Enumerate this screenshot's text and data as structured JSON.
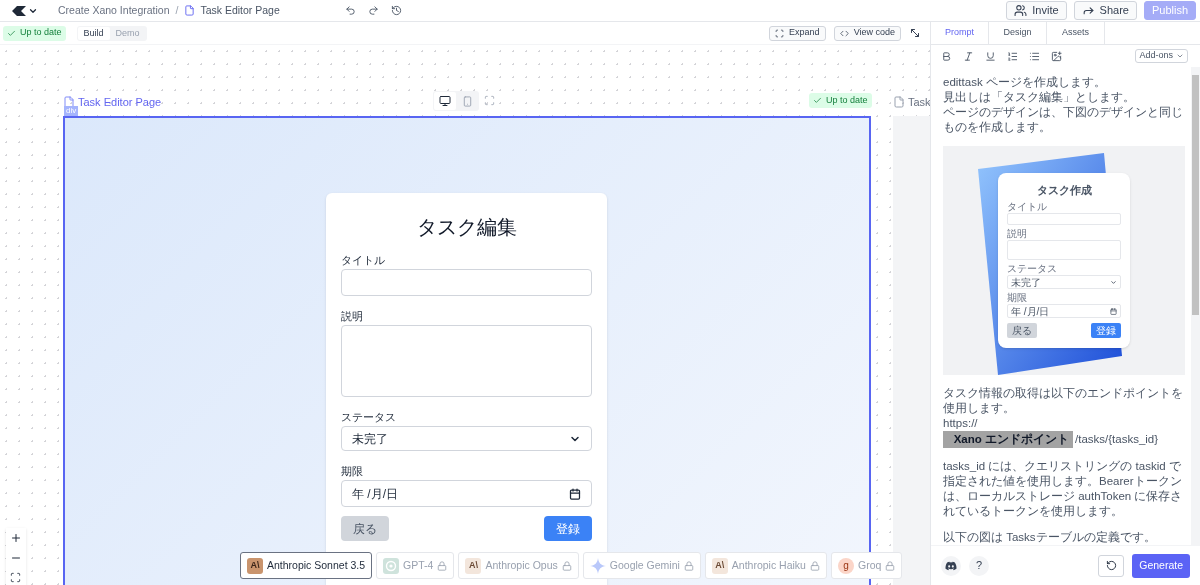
{
  "topbar": {
    "project": "Create Xano Integration",
    "separator": "/",
    "page": "Task Editor Page",
    "buttons": [
      {
        "label": "Invite",
        "kind": "invite"
      },
      {
        "label": "Share",
        "kind": "share"
      },
      {
        "label": "Publish",
        "kind": "publish"
      }
    ]
  },
  "toolbar": {
    "status": "Up to date",
    "modes": [
      {
        "label": "Build",
        "selected": true
      },
      {
        "label": "Demo",
        "selected": false
      }
    ],
    "buttons": [
      {
        "label": "Expand",
        "kind": "expand"
      },
      {
        "label": "View code",
        "kind": "code"
      }
    ]
  },
  "canvas": {
    "frame": {
      "title": "Task Editor Page",
      "tag": "div",
      "status": "Up to date",
      "devices": [
        {
          "kind": "desktop",
          "selected": true
        },
        {
          "kind": "mobile",
          "selected": false
        }
      ],
      "form": {
        "heading": "タスク編集",
        "fields": [
          {
            "label": "タイトル",
            "kind": "text"
          },
          {
            "label": "説明",
            "kind": "textarea"
          },
          {
            "label": "ステータス",
            "kind": "select",
            "value": "未完了"
          },
          {
            "label": "期限",
            "kind": "date",
            "value": "年 /月/日"
          }
        ],
        "buttons": [
          {
            "label": "戻る",
            "kind": "secondary"
          },
          {
            "label": "登録",
            "kind": "primary"
          }
        ]
      }
    },
    "next_frame": {
      "title": "Task"
    },
    "models": [
      {
        "name": "Anthropic Sonnet 3.5",
        "kind": "anthropic",
        "logo": "A\\",
        "selected": true,
        "locked": false
      },
      {
        "name": "GPT-4",
        "kind": "openai",
        "selected": false,
        "locked": true
      },
      {
        "name": "Anthropic Opus",
        "kind": "anthropic",
        "logo": "A\\",
        "selected": false,
        "locked": true
      },
      {
        "name": "Google Gemini",
        "kind": "gemini",
        "selected": false,
        "locked": true
      },
      {
        "name": "Anthropic Haiku",
        "kind": "anthropic",
        "logo": "A\\",
        "selected": false,
        "locked": true
      },
      {
        "name": "Groq",
        "kind": "groq",
        "logo": "g",
        "selected": false,
        "locked": true
      }
    ]
  },
  "panel": {
    "tabs": [
      {
        "label": "Prompt",
        "selected": true
      },
      {
        "label": "Design",
        "selected": false
      },
      {
        "label": "Assets",
        "selected": false
      }
    ],
    "addons": "Add-ons",
    "blocks": [
      {
        "kind": "lines",
        "lines": [
          "edittask ページを作成します。",
          "見出しは「タスク編集」とします。",
          "ページのデザインは、下図のデザインと同じものを作成します。"
        ]
      },
      {
        "kind": "image",
        "form": {
          "heading": "タスク作成",
          "fields": [
            {
              "label": "タイトル",
              "kind": "text"
            },
            {
              "label": "説明",
              "kind": "textarea"
            },
            {
              "label": "ステータス",
              "kind": "select",
              "value": "未完了"
            },
            {
              "label": "期限",
              "kind": "date",
              "value": "年 /月/日"
            }
          ],
          "buttons": [
            {
              "label": "戻る",
              "kind": "secondary"
            },
            {
              "label": "登録",
              "kind": "primary"
            }
          ]
        }
      },
      {
        "kind": "lines",
        "lines": [
          "タスク情報の取得は以下のエンドポイントを使用します。",
          "https://"
        ]
      },
      {
        "kind": "endpoint",
        "redaction": "Xano エンドポイント",
        "path": "/tasks/{tasks_id}"
      },
      {
        "kind": "lines",
        "lines": [
          "tasks_id には、クエリストリングの taskid で指定された値を使用します。Bearerトークンは、ローカルストレージ authToken に保存されているトークンを使用します。"
        ]
      },
      {
        "kind": "lines",
        "lines": [
          "以下の図は Tasksテーブルの定義です。"
        ]
      }
    ],
    "help": "?",
    "generate": "Generate"
  }
}
